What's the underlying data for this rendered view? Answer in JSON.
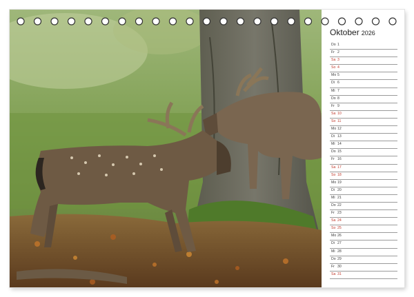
{
  "calendar": {
    "month": "Oktober",
    "year": "2026",
    "colors": {
      "weekend": "#c0392b",
      "text": "#3a3a3a",
      "rule": "#9a9a9a"
    },
    "days": [
      {
        "wd": "Do",
        "d": "1",
        "we": false
      },
      {
        "wd": "Fr",
        "d": "2",
        "we": false
      },
      {
        "wd": "Sa",
        "d": "3",
        "we": true
      },
      {
        "wd": "So",
        "d": "4",
        "we": true
      },
      {
        "wd": "Mo",
        "d": "5",
        "we": false
      },
      {
        "wd": "Di",
        "d": "6",
        "we": false
      },
      {
        "wd": "Mi",
        "d": "7",
        "we": false
      },
      {
        "wd": "Do",
        "d": "8",
        "we": false
      },
      {
        "wd": "Fr",
        "d": "9",
        "we": false
      },
      {
        "wd": "Sa",
        "d": "10",
        "we": true
      },
      {
        "wd": "So",
        "d": "11",
        "we": true
      },
      {
        "wd": "Mo",
        "d": "12",
        "we": false
      },
      {
        "wd": "Di",
        "d": "13",
        "we": false
      },
      {
        "wd": "Mi",
        "d": "14",
        "we": false
      },
      {
        "wd": "Do",
        "d": "15",
        "we": false
      },
      {
        "wd": "Fr",
        "d": "16",
        "we": false
      },
      {
        "wd": "Sa",
        "d": "17",
        "we": true
      },
      {
        "wd": "So",
        "d": "18",
        "we": true
      },
      {
        "wd": "Mo",
        "d": "19",
        "we": false
      },
      {
        "wd": "Di",
        "d": "20",
        "we": false
      },
      {
        "wd": "Mi",
        "d": "21",
        "we": false
      },
      {
        "wd": "Do",
        "d": "22",
        "we": false
      },
      {
        "wd": "Fr",
        "d": "23",
        "we": false
      },
      {
        "wd": "Sa",
        "d": "24",
        "we": true
      },
      {
        "wd": "So",
        "d": "25",
        "we": true
      },
      {
        "wd": "Mo",
        "d": "26",
        "we": false
      },
      {
        "wd": "Di",
        "d": "27",
        "we": false
      },
      {
        "wd": "Mi",
        "d": "28",
        "we": false
      },
      {
        "wd": "Do",
        "d": "29",
        "we": false
      },
      {
        "wd": "Fr",
        "d": "30",
        "we": false
      },
      {
        "wd": "Sa",
        "d": "31",
        "we": true
      }
    ]
  },
  "photo": {
    "subject": "two-fallow-deer-stags-sparring-illustration"
  }
}
